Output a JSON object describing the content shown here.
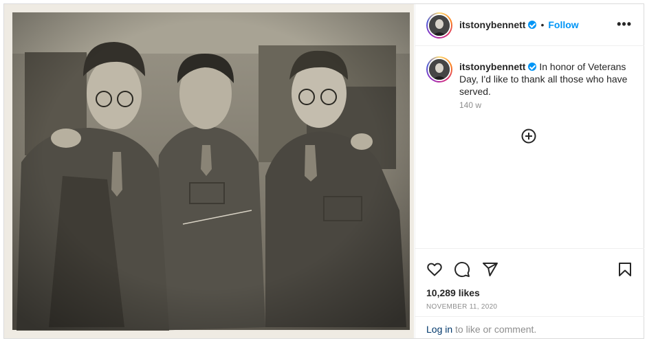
{
  "post": {
    "username": "itstonybennett",
    "dot": "•",
    "follow_label": "Follow",
    "more_label": "•••",
    "caption_text": "In honor of Veterans Day, I'd like to thank all those who have served.",
    "caption_time": "140 w",
    "likes_text": "10,289 likes",
    "date": "NOVEMBER 11, 2020",
    "login_link": "Log in",
    "login_suffix": " to like or comment."
  },
  "icons": {
    "verified": "verified-badge-icon",
    "add": "add-circle-icon",
    "like": "heart-icon",
    "comment": "comment-icon",
    "share": "share-icon",
    "save": "bookmark-icon"
  },
  "colors": {
    "accent": "#0095f6",
    "link": "#00376b",
    "muted": "#8e8e8e",
    "text": "#262626"
  }
}
